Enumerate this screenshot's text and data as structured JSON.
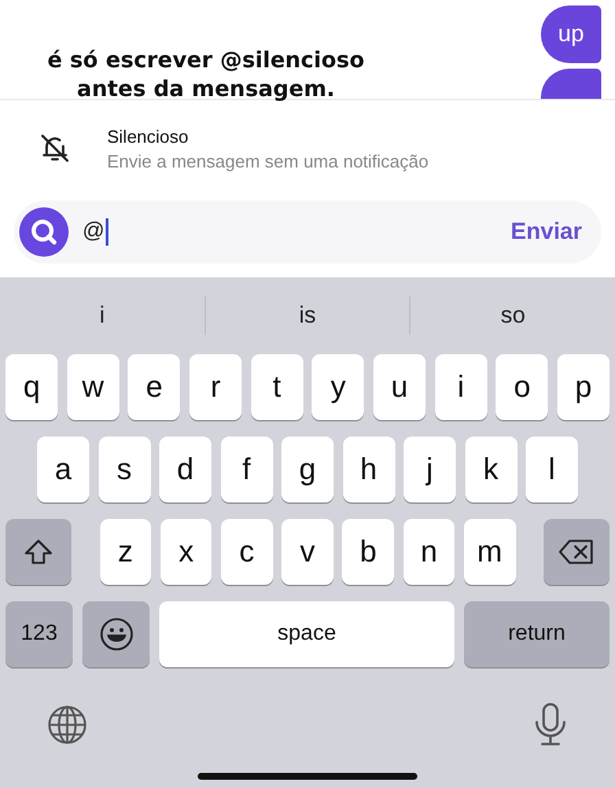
{
  "chat": {
    "caption": [
      "é só escrever @silencioso",
      "antes da mensagem."
    ],
    "bubbles": [
      {
        "kind": "text",
        "label": "up"
      },
      {
        "kind": "covered"
      }
    ]
  },
  "mention": {
    "title": "Silencioso",
    "subtitle": "Envie a mensagem sem uma notificação"
  },
  "composer": {
    "value": "@",
    "send": "Enviar"
  },
  "keyboard": {
    "suggestions": [
      "i",
      "is",
      "so"
    ],
    "rows": [
      [
        "q",
        "w",
        "e",
        "r",
        "t",
        "y",
        "u",
        "i",
        "o",
        "p"
      ],
      [
        "a",
        "s",
        "d",
        "f",
        "g",
        "h",
        "j",
        "k",
        "l"
      ],
      [
        "z",
        "x",
        "c",
        "v",
        "b",
        "n",
        "m"
      ]
    ],
    "numbers": "123",
    "space": "space",
    "return": "return"
  }
}
